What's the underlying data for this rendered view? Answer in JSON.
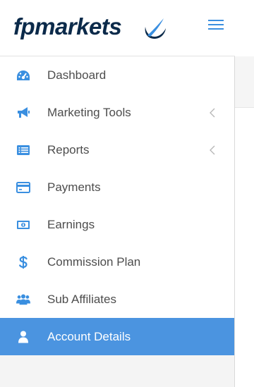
{
  "brand": {
    "logo_text": "fpmarkets",
    "logo_mark_icon": "fp-swoosh-icon",
    "menu_toggle_icon": "hamburger-icon"
  },
  "colors": {
    "accent": "#4b94e0",
    "logo": "#0b2a4a",
    "icon": "#3a8fe0",
    "text": "#4d4d4d"
  },
  "menu": {
    "items": [
      {
        "label": "Dashboard",
        "icon": "dashboard-gauge-icon",
        "has_submenu": false,
        "active": false
      },
      {
        "label": "Marketing Tools",
        "icon": "megaphone-icon",
        "has_submenu": true,
        "active": false
      },
      {
        "label": "Reports",
        "icon": "list-report-icon",
        "has_submenu": true,
        "active": false
      },
      {
        "label": "Payments",
        "icon": "credit-card-icon",
        "has_submenu": false,
        "active": false
      },
      {
        "label": "Earnings",
        "icon": "money-icon",
        "has_submenu": false,
        "active": false
      },
      {
        "label": "Commission Plan",
        "icon": "dollar-icon",
        "has_submenu": false,
        "active": false
      },
      {
        "label": "Sub Affiliates",
        "icon": "users-icon",
        "has_submenu": false,
        "active": false
      },
      {
        "label": "Account Details",
        "icon": "user-icon",
        "has_submenu": false,
        "active": true
      }
    ]
  }
}
